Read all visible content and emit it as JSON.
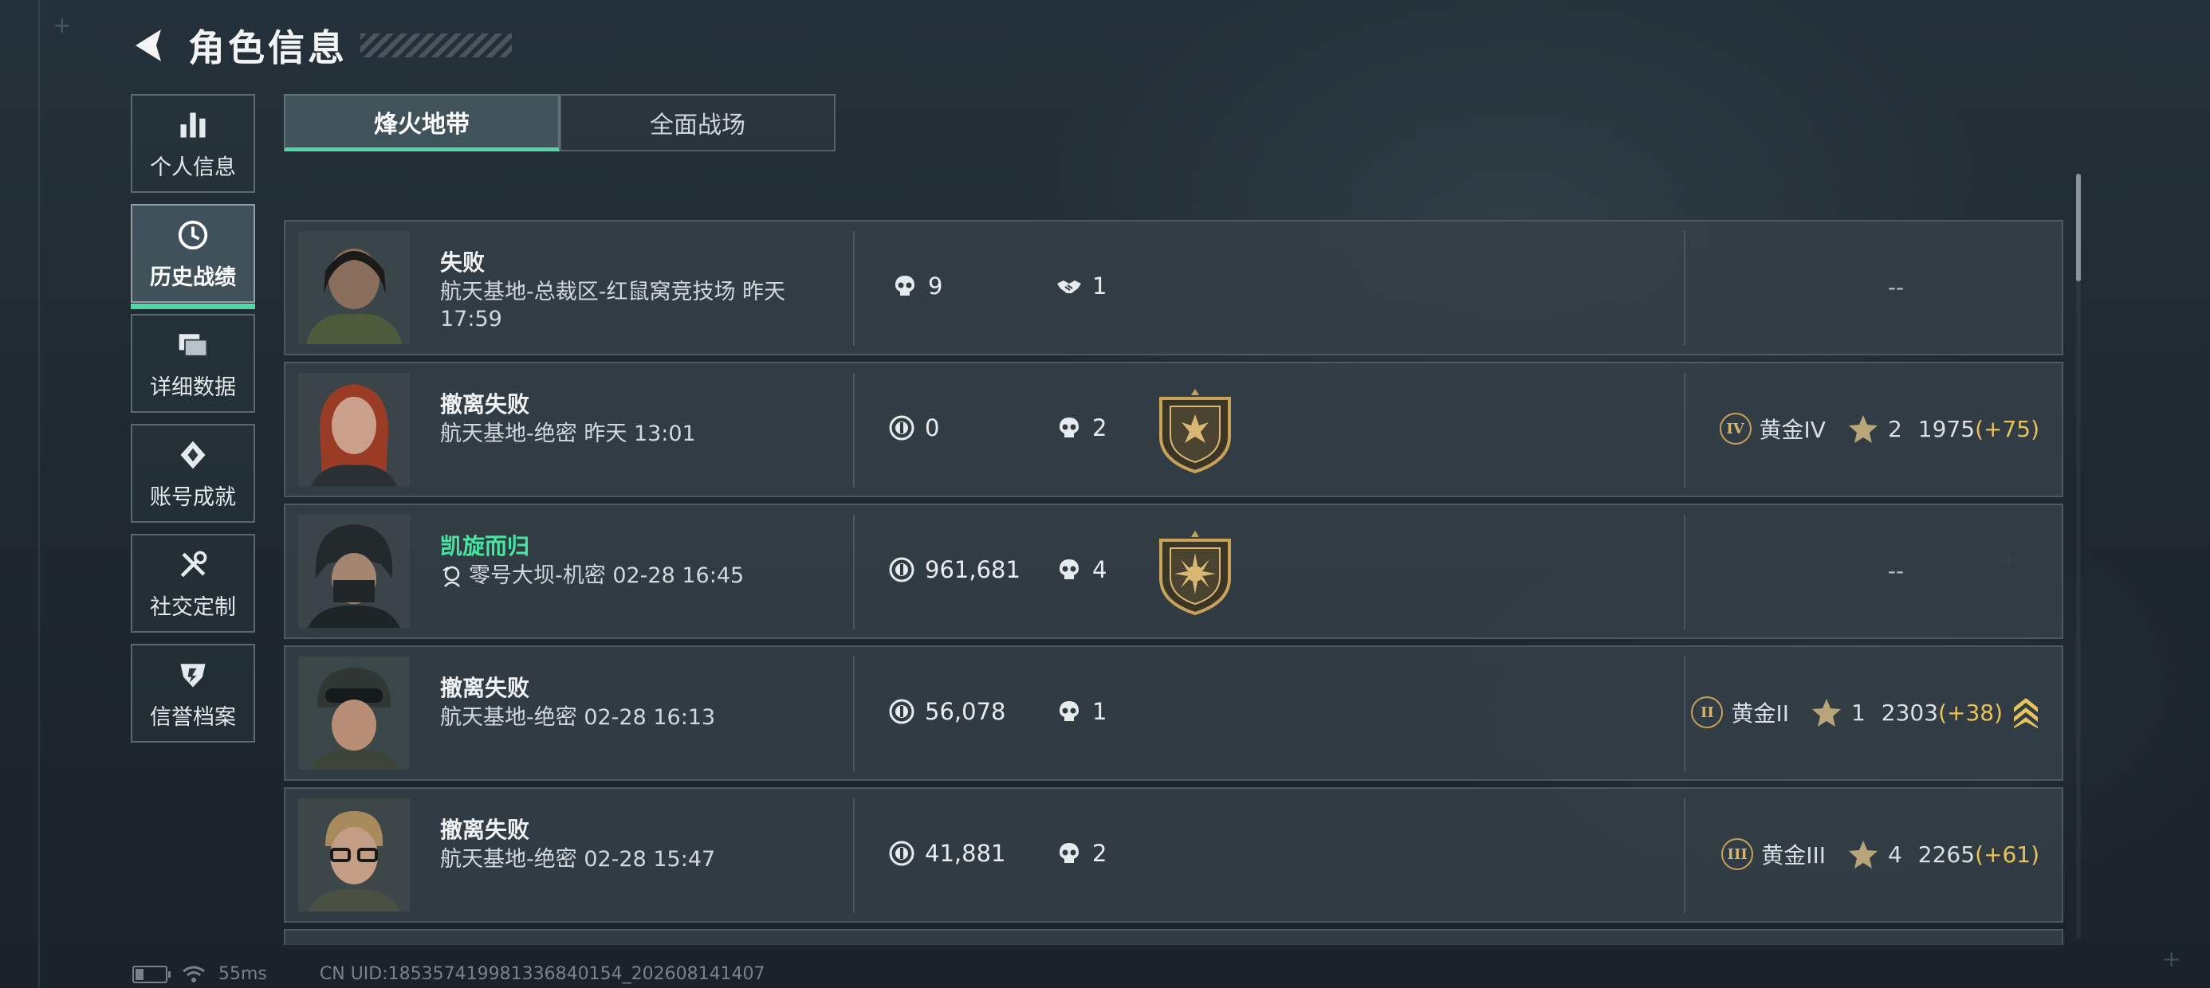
{
  "header": {
    "title": "角色信息",
    "back_icon": "back-arrow-icon"
  },
  "sidebar": {
    "items": [
      {
        "label": "个人信息",
        "icon": "bar-chart-icon",
        "active": false
      },
      {
        "label": "历史战绩",
        "icon": "history-clock-icon",
        "active": true
      },
      {
        "label": "详细数据",
        "icon": "folders-icon",
        "active": false
      },
      {
        "label": "账号成就",
        "icon": "achievement-diamond-icon",
        "active": false
      },
      {
        "label": "社交定制",
        "icon": "wrench-tools-icon",
        "active": false
      },
      {
        "label": "信誉档案",
        "icon": "credit-emblem-icon",
        "active": false
      }
    ]
  },
  "tabs": [
    {
      "label": "烽火地带",
      "active": true
    },
    {
      "label": "全面战场",
      "active": false
    }
  ],
  "matches": [
    {
      "result": "失败",
      "win": false,
      "map": "航天基地-总裁区-红鼠窝竞技场 昨天 17:59",
      "stat1_icon": "skull-icon",
      "stat1": "9",
      "stat2_icon": "handshake-icon",
      "stat2": "1",
      "badge": "",
      "rank": null,
      "rank_text": "--"
    },
    {
      "result": "撤离失败",
      "win": false,
      "map": "航天基地-绝密 昨天 13:01",
      "stat1_icon": "coin-icon",
      "stat1": "0",
      "stat2_icon": "skull-icon",
      "stat2": "2",
      "badge": "shield-eagle-badge",
      "rank": {
        "numeral": "IV",
        "tier": "黄金IV",
        "stars": "2",
        "score": "1975",
        "gain": "(+75)",
        "chevron": false
      }
    },
    {
      "result": "凯旋而归",
      "win": true,
      "map": "零号大坝-机密 02-28 16:45",
      "map_icon": "operator-mini-icon",
      "stat1_icon": "coin-icon",
      "stat1": "961,681",
      "stat2_icon": "skull-icon",
      "stat2": "4",
      "badge": "shield-burst-badge",
      "rank": null,
      "rank_text": "--"
    },
    {
      "result": "撤离失败",
      "win": false,
      "map": "航天基地-绝密 02-28 16:13",
      "stat1_icon": "coin-icon",
      "stat1": "56,078",
      "stat2_icon": "skull-icon",
      "stat2": "1",
      "badge": "",
      "rank": {
        "numeral": "II",
        "tier": "黄金II",
        "stars": "1",
        "score": "2303",
        "gain": "(+38)",
        "chevron": true
      }
    },
    {
      "result": "撤离失败",
      "win": false,
      "map": "航天基地-绝密 02-28 15:47",
      "stat1_icon": "coin-icon",
      "stat1": "41,881",
      "stat2_icon": "skull-icon",
      "stat2": "2",
      "badge": "",
      "rank": {
        "numeral": "III",
        "tier": "黄金III",
        "stars": "4",
        "score": "2265",
        "gain": "(+61)",
        "chevron": false
      }
    }
  ],
  "footer": {
    "ping": "55ms",
    "uid": "CN UID:1853574199813368401​54_202608141407"
  },
  "colors": {
    "accent": "#52d6a6",
    "win": "#47e6a3",
    "gain": "#e8c25c",
    "gold": "#c9a25a"
  }
}
